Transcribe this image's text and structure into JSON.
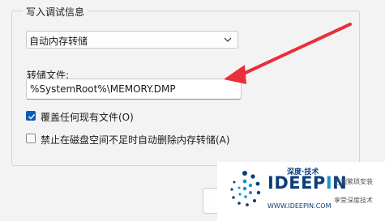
{
  "group": {
    "title": "写入调试信息"
  },
  "dump_type": {
    "selected": "自动内存转储"
  },
  "dump_file": {
    "label": "转储文件:",
    "value": "%SystemRoot%\\MEMORY.DMP"
  },
  "overwrite": {
    "label": "覆盖任何现有文件(O)",
    "checked": true
  },
  "disable_auto_delete": {
    "label": "禁止在磁盘空间不足时自动删除内存转储(A)",
    "checked": false
  },
  "watermark": {
    "tagline": "深度·技术",
    "brand_prefix": "IDEEP",
    "brand_i": "I",
    "brand_suffix": "N",
    "url": "WWW.IDEEPIN.COM",
    "slogan1": "告别繁琐安装",
    "slogan2": "享受深度技术"
  },
  "colors": {
    "accent": "#0a5fb4",
    "arrow": "#e8303a",
    "brand": "#0b3f7a"
  }
}
